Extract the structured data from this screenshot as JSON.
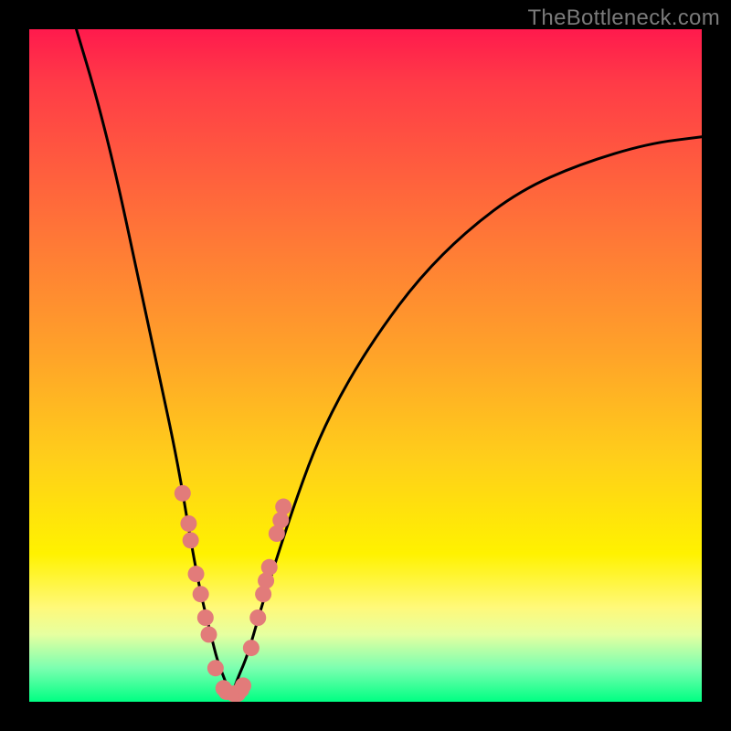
{
  "watermark": "TheBottleneck.com",
  "chart_data": {
    "type": "line",
    "title": "",
    "xlabel": "",
    "ylabel": "",
    "xlim": [
      0,
      100
    ],
    "ylim": [
      0,
      100
    ],
    "grid": false,
    "legend": null,
    "series": [
      {
        "name": "curve",
        "x": [
          7,
          10,
          13,
          16,
          19,
          22,
          24,
          25.5,
          27,
          28,
          29,
          29.5,
          30,
          30.5,
          31,
          32.5,
          34.5,
          37,
          40,
          43,
          47,
          52,
          58,
          65,
          73,
          82,
          92,
          100
        ],
        "y": [
          100,
          90,
          78,
          64,
          50,
          36,
          24,
          16,
          10,
          6,
          3.5,
          2,
          1.2,
          2,
          3.5,
          7,
          14,
          22,
          31,
          39,
          47,
          55,
          63,
          70,
          76,
          80,
          83,
          84
        ]
      }
    ],
    "points": {
      "name": "dots",
      "x": [
        22.8,
        23.7,
        24.0,
        24.8,
        25.5,
        26.2,
        26.7,
        27.7,
        28.9,
        29.3,
        30.4,
        31.0,
        31.5,
        31.8,
        33.0,
        34.0,
        34.8,
        35.2,
        35.7,
        36.8,
        37.4,
        37.8
      ],
      "y": [
        31.0,
        26.5,
        24.0,
        19.0,
        16.0,
        12.5,
        10.0,
        5.0,
        2.0,
        1.5,
        1.2,
        1.2,
        1.8,
        2.4,
        8.0,
        12.5,
        16.0,
        18.0,
        20.0,
        25.0,
        27.0,
        29.0
      ]
    },
    "colors": {
      "curve": "#000000",
      "dots": "#e27b7a"
    }
  }
}
